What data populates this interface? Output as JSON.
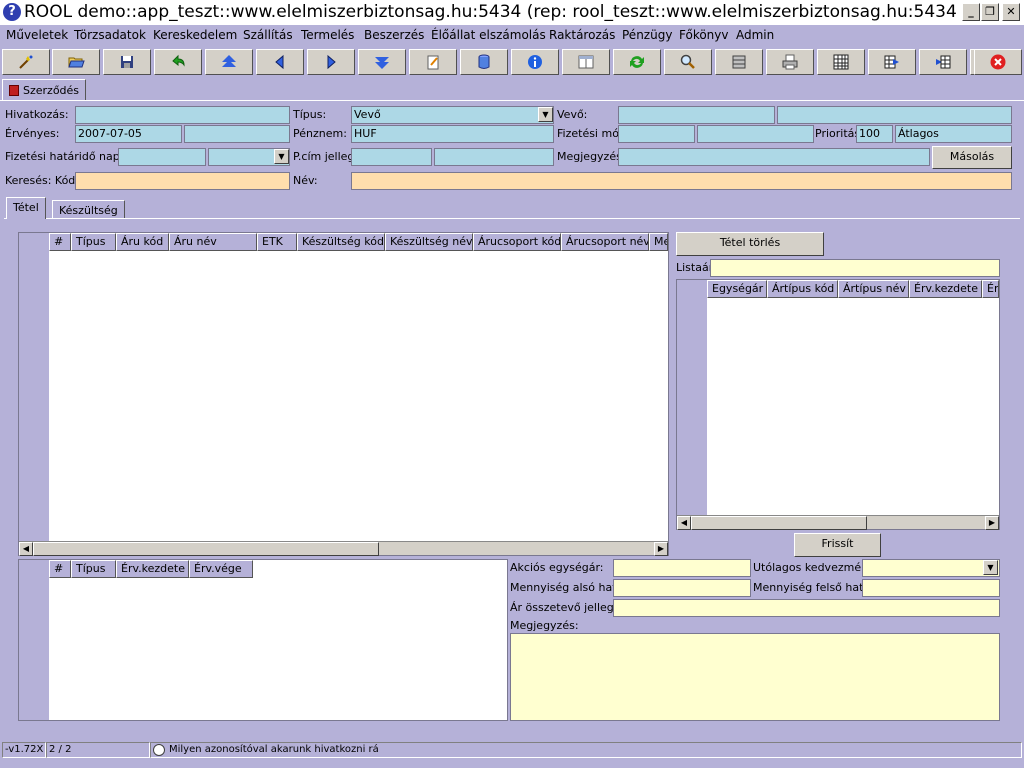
{
  "window": {
    "title": "ROOL demo::app_teszt::www.elelmiszerbiztonsag.hu:5434 (rep: rool_teszt::www.elelmiszerbiztonsag.hu:5434) ...",
    "minimize": "_",
    "restore": "❐",
    "close": "✕"
  },
  "menu": [
    "Műveletek",
    "Törzsadatok",
    "Kereskedelem",
    "Szállítás",
    "Termelés",
    "Beszerzés",
    "Élőállat elszámolás",
    "Raktározás",
    "Pénzügy",
    "Főkönyv",
    "Admin"
  ],
  "toolbar_icons": [
    "wizard-icon",
    "open-folder-icon",
    "save-icon",
    "undo-icon",
    "first-record-icon",
    "previous-icon",
    "next-icon",
    "last-record-icon",
    "edit-icon",
    "database-icon",
    "info-icon",
    "form-view-icon",
    "refresh-icon",
    "search-icon",
    "columns-icon",
    "print-icon",
    "grid-icon",
    "export-icon",
    "import-icon",
    "fullscreen-icon",
    "exit-icon"
  ],
  "document_tab": "Szerződés",
  "form": {
    "hivatkozas_label": "Hivatkozás:",
    "tipus_label": "Típus:",
    "tipus_value": "Vevő",
    "vevo_label": "Vevő:",
    "ervenyes_label": "Érvényes:",
    "ervenyes_value": "2007-07-05",
    "penznem_label": "Pénznem:",
    "penznem_value": "HUF",
    "fizetesi_mod_label": "Fizetési mód:",
    "prioritas_label": "Prioritás:",
    "prioritas_value": "100",
    "prioritas_text": "Átlagos",
    "fizetesi_napok_label": "Fizetési határidő napok:",
    "pcim_label": "P.cím jelleg:",
    "megjegyzes_label": "Megjegyzés:",
    "masolas_button": "Másolás",
    "kereses_label": "Keresés: Kód:",
    "nev_label": "Név:"
  },
  "inner_tabs": [
    "Tétel",
    "Készültség"
  ],
  "items_grid": {
    "columns": [
      "#",
      "Típus",
      "Áru kód",
      "Áru név",
      "ETK",
      "Készültség kód",
      "Készültség név",
      "Árucsoport kód",
      "Árucsoport név",
      "Me"
    ]
  },
  "right_panel": {
    "delete_button": "Tétel törlés",
    "listaar_label": "Listaár:",
    "price_columns": [
      "Egységár",
      "Ártípus kód",
      "Ártípus név",
      "Érv.kezdete",
      "Érv"
    ],
    "refresh_button": "Frissít"
  },
  "bottom_grid": {
    "columns": [
      "#",
      "Típus",
      "Érv.kezdete",
      "Érv.vége"
    ]
  },
  "details": {
    "akcios_label": "Akciós egységár:",
    "utolagos_label": "Utólagos kedvezmény:",
    "menny_also_label": "Mennyiség alsó határ:",
    "menny_felso_label": "Mennyiség felső határ:",
    "ar_osszetevo_label": "Ár összetevő jelleg:",
    "megjegyzes_label": "Megjegyzés:"
  },
  "status": {
    "version": "-v1.72X",
    "pages": "2 / 2",
    "hint": "Milyen azonosítóval akarunk hivatkozni rá"
  },
  "colors": {
    "background": "#b5b1d8",
    "field_blue": "#add8e6",
    "field_orange": "#ffdead",
    "field_yellow": "#ffffd0"
  }
}
